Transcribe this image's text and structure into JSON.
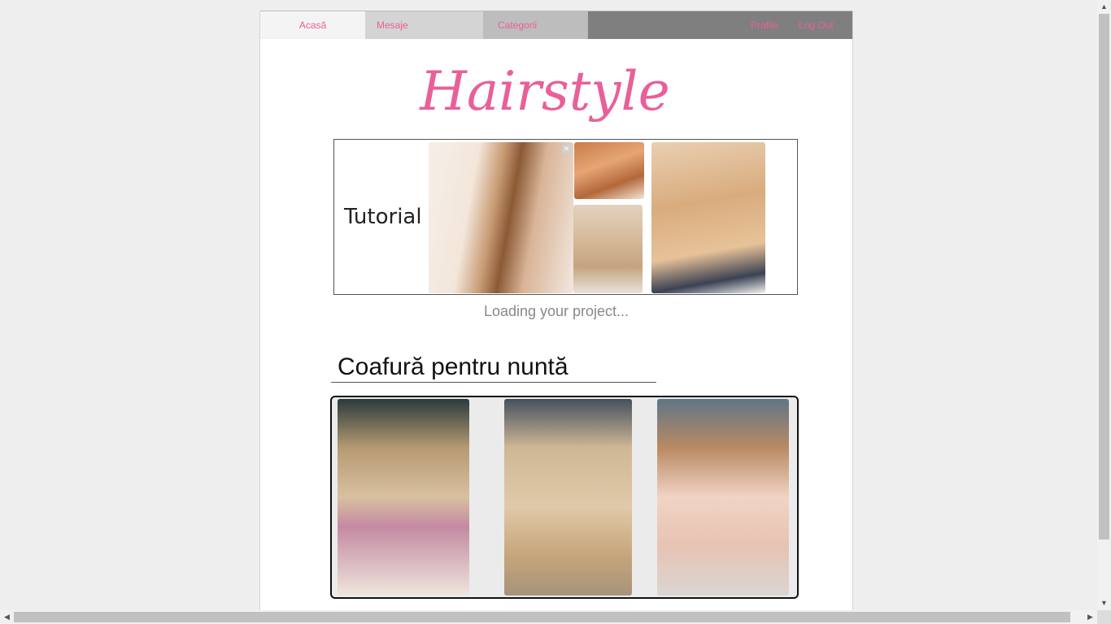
{
  "nav": {
    "home": "Acasă",
    "messages": "Mesaje",
    "categories": "Categorii",
    "profile": "Profile",
    "logout": "Log Out"
  },
  "logo": {
    "text": "Hairstyle"
  },
  "banner": {
    "label": "Tutorial",
    "close_glyph": "✕"
  },
  "loading": {
    "text": "Loading your project..."
  },
  "section": {
    "title": "Coafură pentru nuntă"
  },
  "colors": {
    "accent": "#e8609a",
    "nav_dark": "#7f7f7f"
  },
  "scrollbars": {
    "up": "▲",
    "down": "▼",
    "left": "◀",
    "right": "▶"
  }
}
